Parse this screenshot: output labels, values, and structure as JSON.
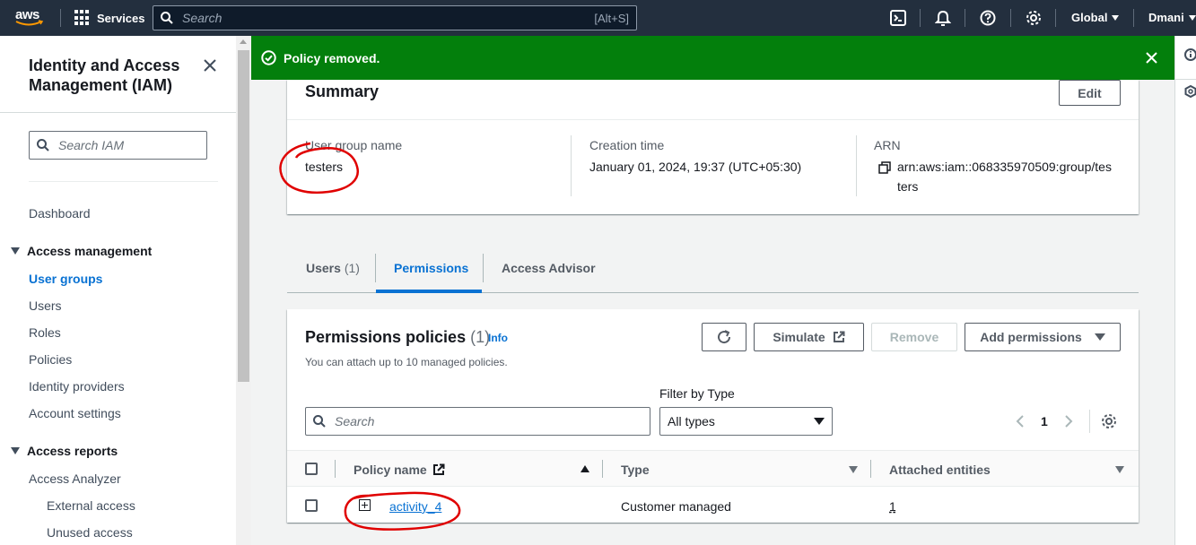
{
  "topnav": {
    "logo": "aws",
    "services_label": "Services",
    "search_placeholder": "Search",
    "search_shortcut": "[Alt+S]",
    "icons": [
      "cloudshell-icon",
      "bell-icon",
      "help-icon",
      "gear-icon"
    ],
    "region_label": "Global",
    "user_label": "Dmani"
  },
  "sidebar": {
    "title": "Identity and Access Management (IAM)",
    "search_placeholder": "Search IAM",
    "dashboard": "Dashboard",
    "section_access_management": "Access management",
    "items": [
      "User groups",
      "Users",
      "Roles",
      "Policies",
      "Identity providers",
      "Account settings"
    ],
    "active_item": "User groups",
    "section_access_reports": "Access reports",
    "reports_items": [
      "Access Analyzer",
      "External access",
      "Unused access"
    ]
  },
  "flash": {
    "message": "Policy removed."
  },
  "summary": {
    "title": "Summary",
    "edit_label": "Edit",
    "group_name_label": "User group name",
    "group_name_value": "testers",
    "creation_label": "Creation time",
    "creation_value": "January 01, 2024, 19:37 (UTC+05:30)",
    "arn_label": "ARN",
    "arn_line1": "arn:aws:iam::068335970509:group/tes",
    "arn_line2": "ters"
  },
  "tabs": [
    {
      "label": "Users",
      "count": "(1)"
    },
    {
      "label": "Permissions",
      "count": ""
    },
    {
      "label": "Access Advisor",
      "count": ""
    }
  ],
  "permissions": {
    "title": "Permissions policies",
    "count": "(1)",
    "info": "Info",
    "description": "You can attach up to 10 managed policies.",
    "simulate_label": "Simulate",
    "remove_label": "Remove",
    "add_label": "Add permissions",
    "filter_label": "Filter by Type",
    "search_placeholder": "Search",
    "filter_value": "All types",
    "page": "1",
    "columns": [
      "Policy name",
      "Type",
      "Attached entities"
    ],
    "rows": [
      {
        "name": "activity_4",
        "type": "Customer managed",
        "attached": "1"
      }
    ]
  },
  "colors": {
    "nav_bg": "#232f3e",
    "flash_green": "#037f0c",
    "link_blue": "#0972d3",
    "annotation_red": "#e00000"
  }
}
